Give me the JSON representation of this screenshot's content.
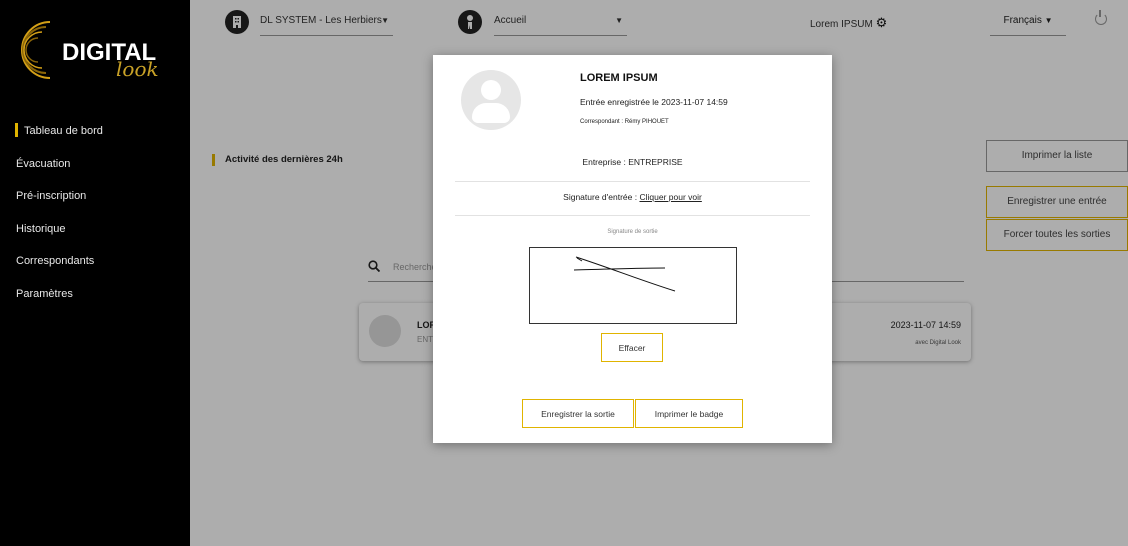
{
  "sidebar": {
    "logo_text": "DIGITAL",
    "logo_script": "look",
    "items": [
      {
        "label": "Tableau de bord"
      },
      {
        "label": "Évacuation"
      },
      {
        "label": "Pré-inscription"
      },
      {
        "label": "Historique"
      },
      {
        "label": "Correspondants"
      },
      {
        "label": "Paramètres"
      }
    ]
  },
  "topbar": {
    "site": "DL SYSTEM - Les Herbiers",
    "page": "Accueil",
    "user": "Lorem IPSUM",
    "language": "Français"
  },
  "main": {
    "section_title": "Activité des dernières 24h",
    "search_placeholder": "Recherche",
    "buttons": {
      "print_list": "Imprimer la liste",
      "register_entry": "Enregistrer une entrée",
      "force_exits": "Forcer toutes les sorties"
    },
    "card": {
      "name": "LOR",
      "sub": "ENT",
      "date": "2023-11-07 14:59",
      "by": "avec Digital Look"
    }
  },
  "modal": {
    "name": "LOREM IPSUM",
    "entry": "Entrée enregistrée le 2023-11-07 14:59",
    "correspondent": "Correspondant : Rémy PIHOUET",
    "company": "Entreprise : ENTREPRISE",
    "signature_label": "Signature d'entrée :",
    "signature_link": "Cliquer pour voir",
    "exit_signature_label": "Signature de sortie",
    "clear_button": "Effacer",
    "exit_button": "Enregistrer la sortie",
    "badge_button": "Imprimer le badge"
  },
  "colors": {
    "accent": "#e0b400",
    "sidebar_bg": "#000000"
  }
}
